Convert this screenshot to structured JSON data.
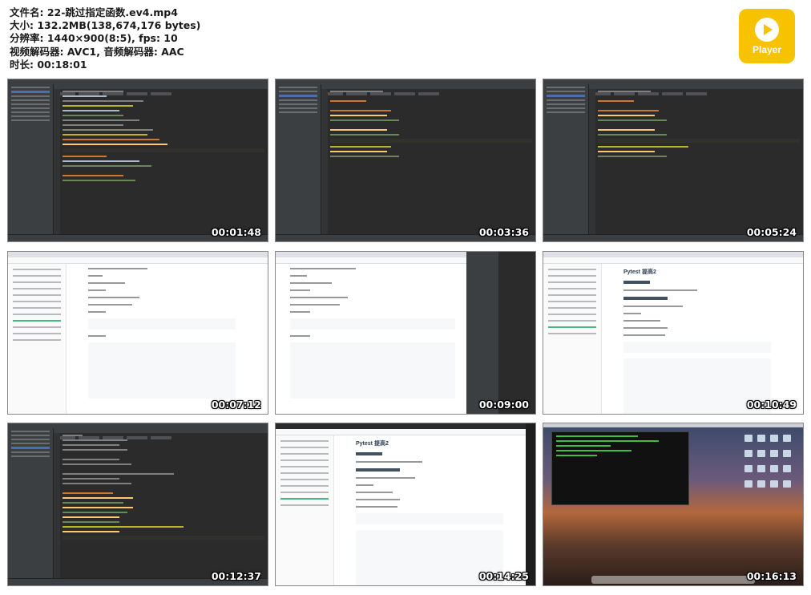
{
  "meta": {
    "filename": "文件名: 22-跳过指定函数.ev4.mp4",
    "size": "大小: 132.2MB(138,674,176 bytes)",
    "resolution": "分辨率: 1440×900(8:5), fps: 10",
    "codecs": "视频解码器: AVC1, 音频解码器: AAC",
    "duration": "时长: 00:18:01"
  },
  "logo": {
    "text": "Player",
    "color": "#f7c300"
  },
  "thumbnails": [
    {
      "kind": "ide",
      "timestamp": "00:01:48"
    },
    {
      "kind": "ide",
      "timestamp": "00:03:36"
    },
    {
      "kind": "ide",
      "timestamp": "00:05:24"
    },
    {
      "kind": "doc",
      "timestamp": "00:07:12"
    },
    {
      "kind": "doc",
      "timestamp": "00:09:00"
    },
    {
      "kind": "doc",
      "timestamp": "00:10:49",
      "title": "Pytest 提高2"
    },
    {
      "kind": "ide",
      "timestamp": "00:12:37"
    },
    {
      "kind": "doc",
      "timestamp": "00:14:25",
      "title": "Pytest 提高2"
    },
    {
      "kind": "desktop",
      "timestamp": "00:16:13"
    }
  ]
}
